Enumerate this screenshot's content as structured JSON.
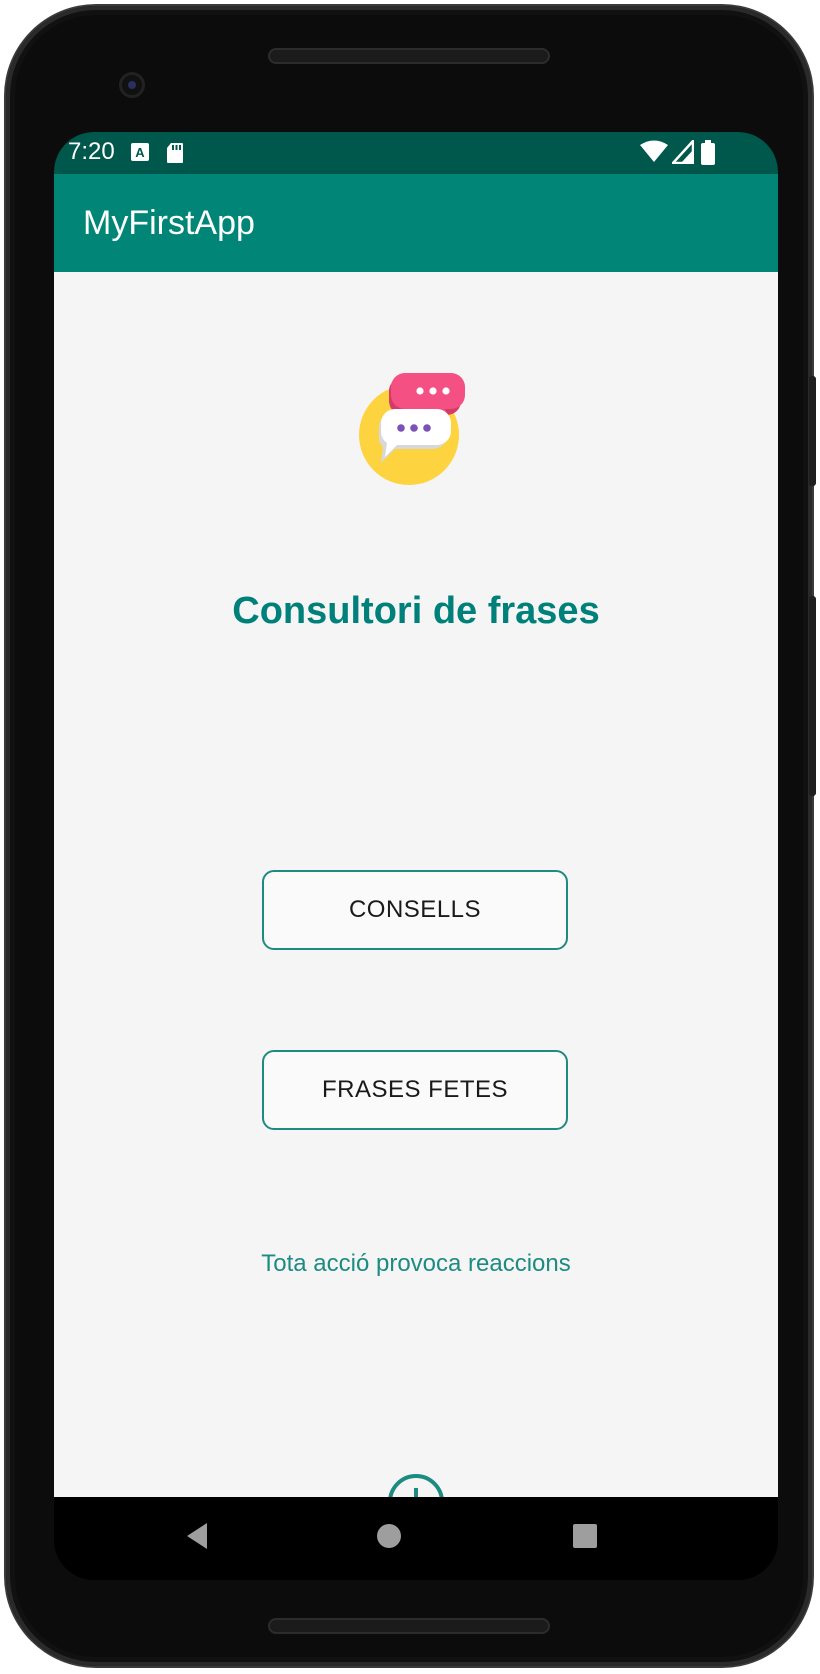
{
  "status_bar": {
    "time": "7:20",
    "notification_icons": [
      "text-a-icon",
      "sd-card-icon"
    ],
    "system_icons": [
      "wifi-icon",
      "cell-signal-icon",
      "battery-icon"
    ]
  },
  "app_bar": {
    "title": "MyFirstApp",
    "color": "#008577",
    "status_color": "#00574b"
  },
  "main": {
    "logo_icon": "chat-bubbles-icon",
    "heading": "Consultori de frases",
    "buttons": [
      {
        "label": "CONSELLS"
      },
      {
        "label": "FRASES FETES"
      }
    ],
    "motto": "Tota acció provoca reaccions",
    "fab_icon": "add-circle-icon",
    "accent_color": "#00807a"
  },
  "nav_bar": {
    "buttons": [
      "back-icon",
      "home-icon",
      "recents-icon"
    ]
  }
}
